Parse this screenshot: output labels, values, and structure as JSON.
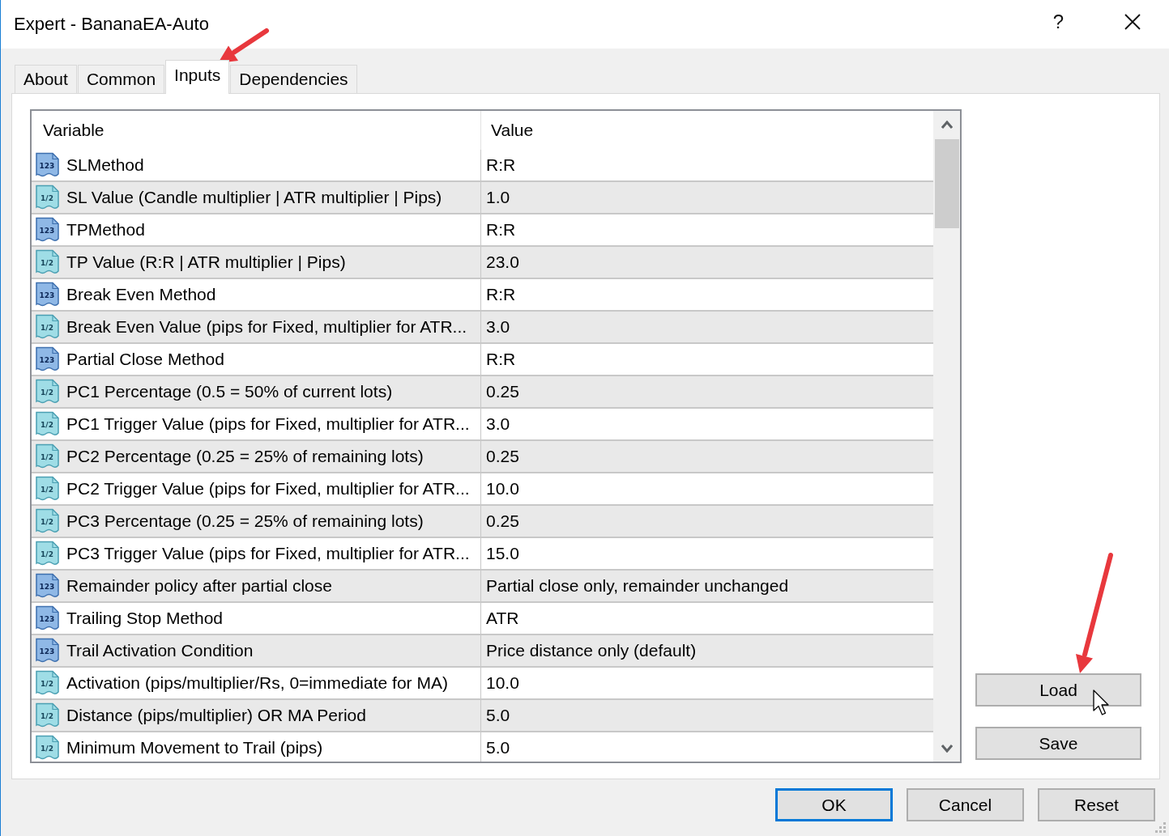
{
  "window": {
    "title": "Expert - BananaEA-Auto",
    "help": "?"
  },
  "tabs": [
    {
      "label": "About",
      "selected": false
    },
    {
      "label": "Common",
      "selected": false
    },
    {
      "label": "Inputs",
      "selected": true
    },
    {
      "label": "Dependencies",
      "selected": false
    }
  ],
  "table": {
    "columns": [
      "Variable",
      "Value"
    ],
    "rows": [
      {
        "kind": "int",
        "icon_text": "123",
        "variable": "SLMethod",
        "value": "R:R"
      },
      {
        "kind": "double",
        "icon_text": "1/2",
        "variable": "SL Value (Candle multiplier | ATR multiplier | Pips)",
        "value": "1.0"
      },
      {
        "kind": "int",
        "icon_text": "123",
        "variable": "TPMethod",
        "value": "R:R"
      },
      {
        "kind": "double",
        "icon_text": "1/2",
        "variable": "TP Value (R:R | ATR multiplier | Pips)",
        "value": "23.0"
      },
      {
        "kind": "int",
        "icon_text": "123",
        "variable": "Break Even Method",
        "value": "R:R"
      },
      {
        "kind": "double",
        "icon_text": "1/2",
        "variable": "Break Even Value (pips for Fixed, multiplier for ATR...",
        "value": "3.0"
      },
      {
        "kind": "int",
        "icon_text": "123",
        "variable": "Partial Close Method",
        "value": "R:R"
      },
      {
        "kind": "double",
        "icon_text": "1/2",
        "variable": "PC1 Percentage (0.5 = 50% of current lots)",
        "value": "0.25"
      },
      {
        "kind": "double",
        "icon_text": "1/2",
        "variable": "PC1 Trigger Value (pips for Fixed, multiplier for ATR...",
        "value": "3.0"
      },
      {
        "kind": "double",
        "icon_text": "1/2",
        "variable": "PC2 Percentage (0.25 = 25% of remaining lots)",
        "value": "0.25"
      },
      {
        "kind": "double",
        "icon_text": "1/2",
        "variable": "PC2 Trigger Value (pips for Fixed, multiplier for ATR...",
        "value": "10.0"
      },
      {
        "kind": "double",
        "icon_text": "1/2",
        "variable": "PC3 Percentage (0.25 = 25% of remaining lots)",
        "value": "0.25"
      },
      {
        "kind": "double",
        "icon_text": "1/2",
        "variable": "PC3 Trigger Value (pips for Fixed, multiplier for ATR...",
        "value": "15.0"
      },
      {
        "kind": "int",
        "icon_text": "123",
        "variable": "Remainder policy after partial close",
        "value": "Partial close only, remainder unchanged"
      },
      {
        "kind": "int",
        "icon_text": "123",
        "variable": "Trailing Stop Method",
        "value": "ATR"
      },
      {
        "kind": "int",
        "icon_text": "123",
        "variable": "Trail Activation Condition",
        "value": "Price distance only (default)"
      },
      {
        "kind": "double",
        "icon_text": "1/2",
        "variable": "Activation (pips/multiplier/Rs, 0=immediate for MA)",
        "value": "10.0"
      },
      {
        "kind": "double",
        "icon_text": "1/2",
        "variable": "Distance (pips/multiplier) OR MA Period",
        "value": "5.0"
      },
      {
        "kind": "double",
        "icon_text": "1/2",
        "variable": "Minimum Movement to Trail (pips)",
        "value": "5.0"
      }
    ]
  },
  "side_buttons": [
    "Load",
    "Save"
  ],
  "buttons": [
    {
      "label": "OK",
      "default": true
    },
    {
      "label": "Cancel",
      "default": false
    },
    {
      "label": "Reset",
      "default": false
    }
  ]
}
